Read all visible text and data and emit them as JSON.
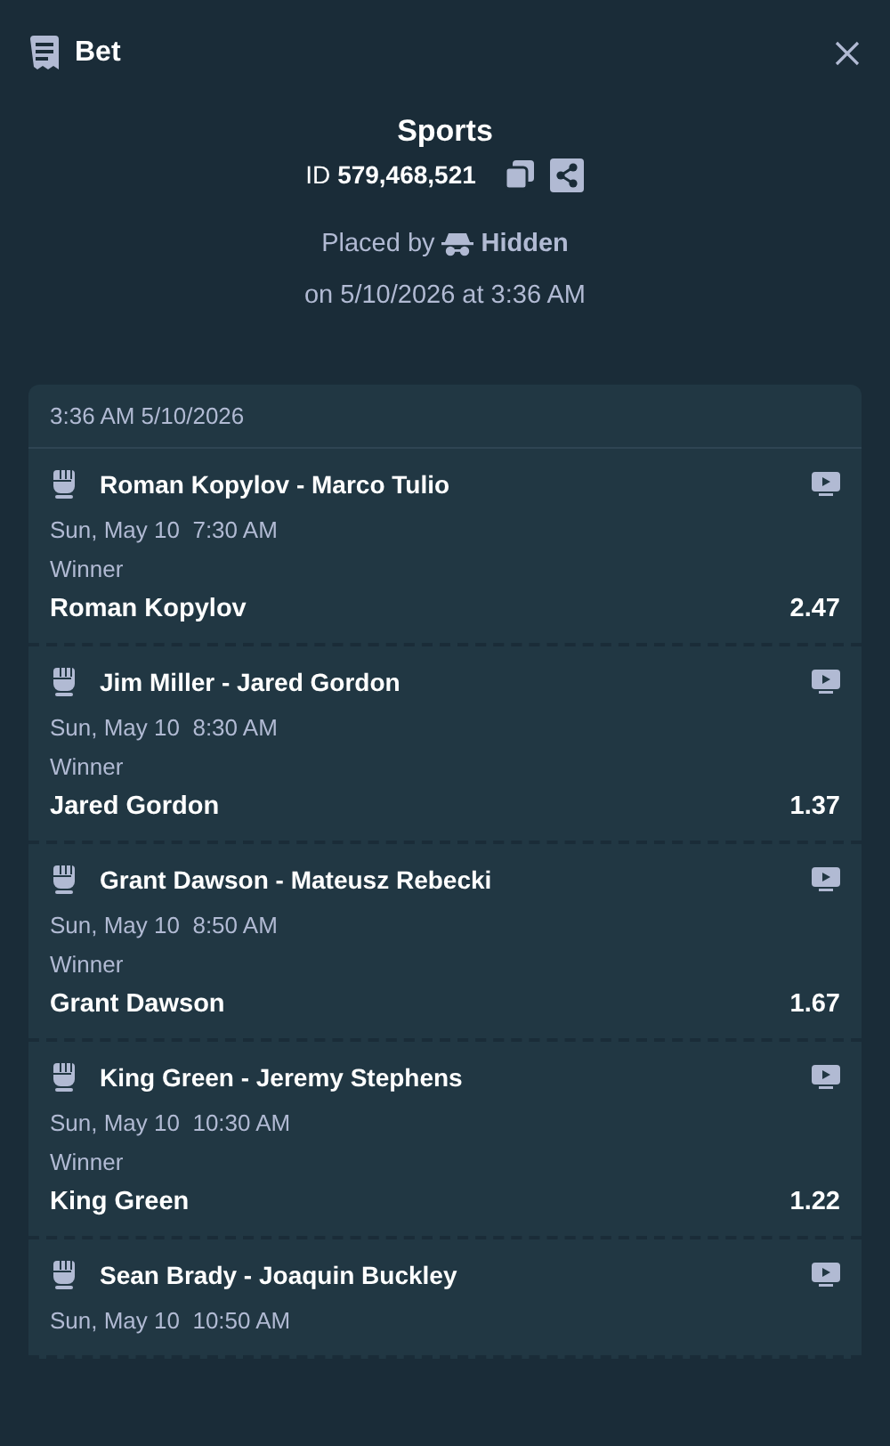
{
  "header": {
    "title": "Bet"
  },
  "summary": {
    "category": "Sports",
    "id_label": "ID",
    "id_value": "579,468,521",
    "placed_by_label": "Placed by",
    "placed_by_user": "Hidden",
    "placed_on": "on 5/10/2026 at 3:36 AM"
  },
  "slip": {
    "timestamp": "3:36 AM 5/10/2026",
    "events": [
      {
        "match": "Roman Kopylov - Marco Tulio",
        "datetime": "Sun, May 10  7:30 AM",
        "market": "Winner",
        "pick": "Roman Kopylov",
        "odds": "2.47"
      },
      {
        "match": "Jim Miller - Jared Gordon",
        "datetime": "Sun, May 10  8:30 AM",
        "market": "Winner",
        "pick": "Jared Gordon",
        "odds": "1.37"
      },
      {
        "match": "Grant Dawson - Mateusz Rebecki",
        "datetime": "Sun, May 10  8:50 AM",
        "market": "Winner",
        "pick": "Grant Dawson",
        "odds": "1.67"
      },
      {
        "match": "King Green - Jeremy Stephens",
        "datetime": "Sun, May 10  10:30 AM",
        "market": "Winner",
        "pick": "King Green",
        "odds": "1.22"
      },
      {
        "match": "Sean Brady - Joaquin Buckley",
        "datetime": "Sun, May 10  10:50 AM"
      }
    ]
  }
}
